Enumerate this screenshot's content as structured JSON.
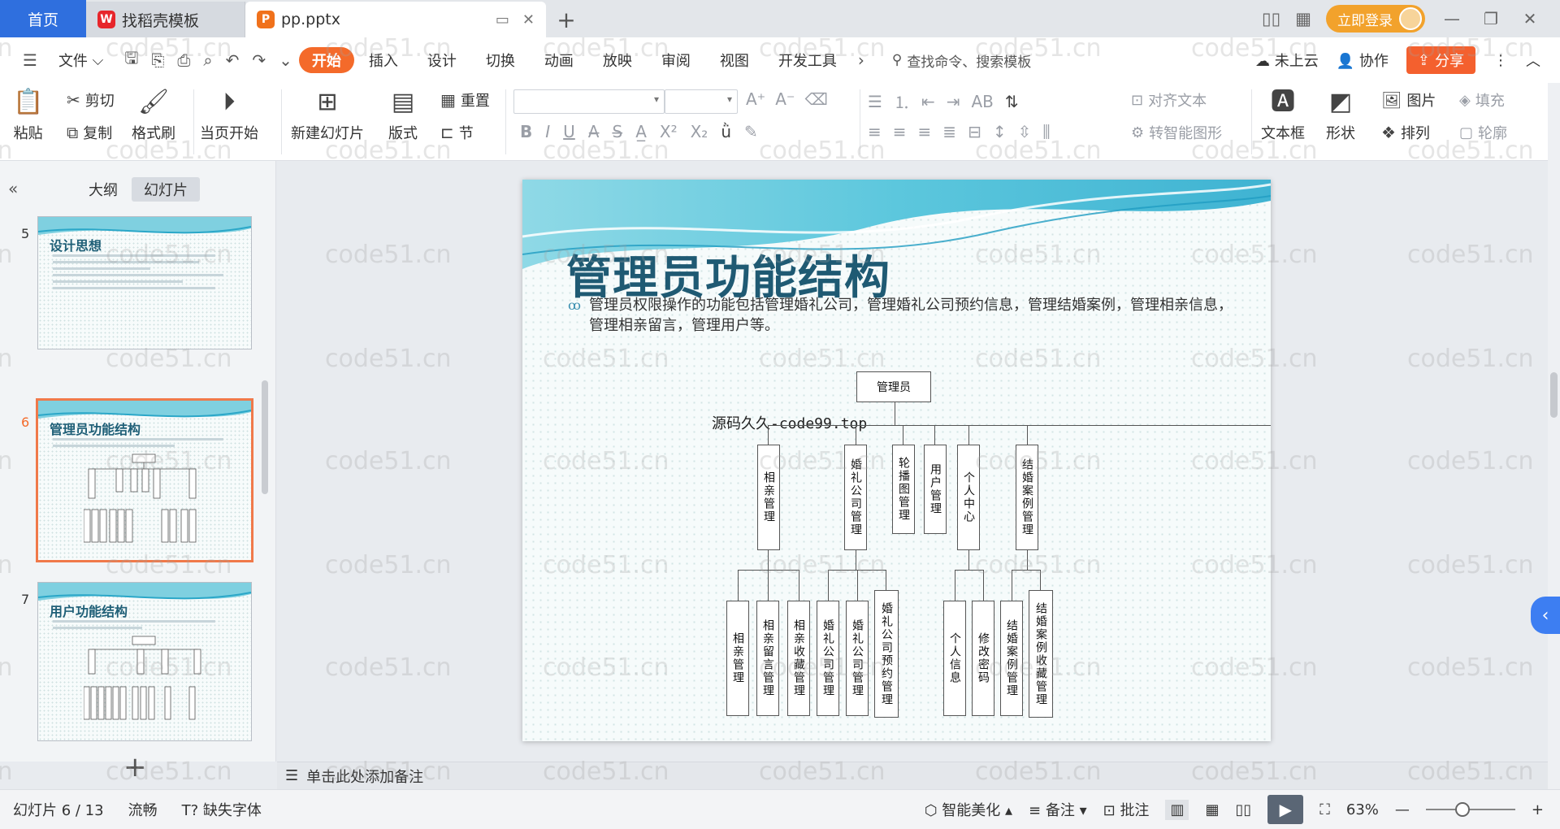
{
  "titlebar": {
    "home_tab": "首页",
    "tab_template": "找稻壳模板",
    "tab_doc": "pp.pptx",
    "login": "立即登录"
  },
  "menubar": {
    "file": "文件",
    "items": [
      "开始",
      "插入",
      "设计",
      "切换",
      "动画",
      "放映",
      "审阅",
      "视图",
      "开发工具"
    ],
    "search": "查找命令、搜索模板",
    "cloud": "未上云",
    "collab": "协作",
    "share": "分享"
  },
  "ribbon": {
    "paste": "粘贴",
    "cut": "剪切",
    "copy": "复制",
    "format_painter": "格式刷",
    "from_current": "当页开始",
    "new_slide": "新建幻灯片",
    "layout": "版式",
    "reset": "重置",
    "section": "节",
    "align_text": "对齐文本",
    "smart_art": "转智能图形",
    "textbox": "文本框",
    "shape": "形状",
    "picture": "图片",
    "arrange": "排列",
    "fill": "填充",
    "outline": "轮廓"
  },
  "leftpanel": {
    "outline_tab": "大纲",
    "slides_tab": "幻灯片",
    "thumbs": [
      {
        "num": "5",
        "title": "设计思想"
      },
      {
        "num": "6",
        "title": "管理员功能结构"
      },
      {
        "num": "7",
        "title": "用户功能结构"
      }
    ]
  },
  "slide": {
    "title": "管理员功能结构",
    "bullet": "管理员权限操作的功能包括管理婚礼公司，管理婚礼公司预约信息，管理结婚案例，管理相亲信息，管理相亲留言，管理用户等。",
    "overlay_text": "源码久久-code99.top",
    "chart": {
      "root": "管理员",
      "level1": [
        "相亲管理",
        "婚礼公司管理",
        "轮播图管理",
        "用户管理",
        "个人中心",
        "结婚案例管理"
      ],
      "level2": {
        "相亲管理": [
          "相亲管理",
          "相亲留言管理",
          "相亲收藏管理"
        ],
        "婚礼公司管理": [
          "婚礼公司管理",
          "婚礼公司管理",
          "婚礼公司预约管理"
        ],
        "个人中心": [
          "个人信息",
          "修改密码"
        ],
        "结婚案例管理": [
          "结婚案例管理",
          "结婚案例收藏管理"
        ]
      }
    }
  },
  "notes": {
    "placeholder": "单击此处添加备注"
  },
  "statusbar": {
    "slide_counter": "幻灯片 6 / 13",
    "smooth": "流畅",
    "missing_font": "缺失字体",
    "beautify": "智能美化",
    "notes_btn": "备注",
    "comment_btn": "批注",
    "zoom": "63%"
  },
  "watermark": "code51.cn",
  "colors": {
    "accent": "#f46a2a",
    "brand_blue": "#2f6fde",
    "title_teal": "#1f5a73"
  }
}
